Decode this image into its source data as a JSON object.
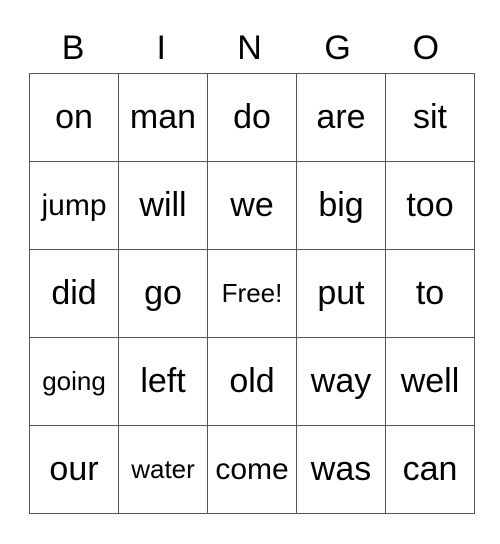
{
  "header": [
    "B",
    "I",
    "N",
    "G",
    "O"
  ],
  "rows": [
    [
      "on",
      "man",
      "do",
      "are",
      "sit"
    ],
    [
      "jump",
      "will",
      "we",
      "big",
      "too"
    ],
    [
      "did",
      "go",
      "Free!",
      "put",
      "to"
    ],
    [
      "going",
      "left",
      "old",
      "way",
      "well"
    ],
    [
      "our",
      "water",
      "come",
      "was",
      "can"
    ]
  ]
}
